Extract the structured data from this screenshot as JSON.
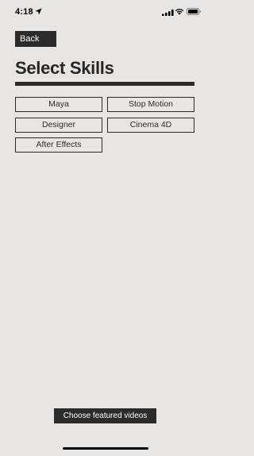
{
  "status_bar": {
    "time": "4:18",
    "icons": [
      "location-arrow-icon",
      "cellular-signal-icon",
      "wifi-icon",
      "battery-icon"
    ]
  },
  "nav": {
    "back_label": "Back"
  },
  "page": {
    "title": "Select Skills"
  },
  "skills": [
    {
      "label": "Maya"
    },
    {
      "label": "Stop Motion"
    },
    {
      "label": "Designer"
    },
    {
      "label": "Cinema 4D"
    },
    {
      "label": "After Effects"
    }
  ],
  "footer": {
    "choose_label": "Choose featured videos"
  },
  "colors": {
    "background": "#e8e6e5",
    "dark": "#2b2b2b",
    "button_text": "#ffffff"
  }
}
